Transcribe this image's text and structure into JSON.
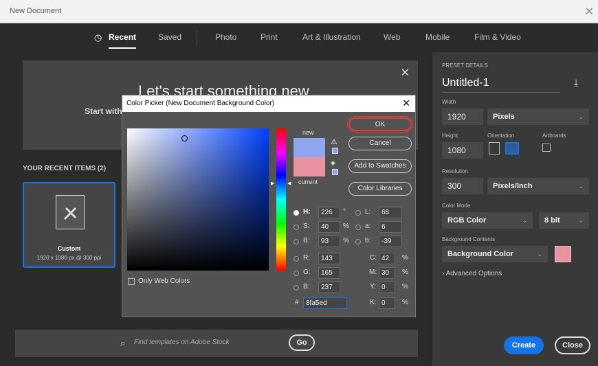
{
  "window": {
    "title": "New Document"
  },
  "nav": {
    "tabs": [
      "Recent",
      "Saved",
      "Photo",
      "Print",
      "Art & Illustration",
      "Web",
      "Mobile",
      "Film & Video"
    ]
  },
  "hero": {
    "heading": "Let's start something new",
    "subtitle": "Start with"
  },
  "recent": {
    "heading": "YOUR RECENT ITEMS",
    "count": "(2)",
    "items": [
      {
        "name": "Custom",
        "dims": "1920 x 1080 px @ 300 ppi"
      }
    ]
  },
  "search": {
    "placeholder": "Find templates on Adobe Stock",
    "go_label": "Go"
  },
  "preset": {
    "section_label": "PRESET DETAILS",
    "name": "Untitled-1",
    "width_label": "Width",
    "width": "1920",
    "width_unit": "Pixels",
    "height_label": "Height",
    "height": "1080",
    "orientation_label": "Orientation",
    "artboards_label": "Artboards",
    "resolution_label": "Resolution",
    "resolution": "300",
    "resolution_unit": "Pixels/Inch",
    "color_mode_label": "Color Mode",
    "color_mode": "RGB Color",
    "bit_depth": "8 bit",
    "bg_label": "Background Contents",
    "bg_value": "Background Color",
    "bg_swatch": "#e8939f",
    "advanced": "Advanced Options"
  },
  "color_picker": {
    "title": "Color Picker (New Document Background Color)",
    "new_label": "new",
    "current_label": "current",
    "new_color": "#8fa5ed",
    "current_color": "#e8939f",
    "ok": "OK",
    "cancel": "Cancel",
    "add_swatches": "Add to Swatches",
    "color_libraries": "Color Libraries",
    "only_web": "Only Web Colors",
    "H": "226",
    "S": "40",
    "B": "93",
    "R": "143",
    "G": "165",
    "Bv": "237",
    "L": "68",
    "a": "6",
    "b": "-39",
    "C": "42",
    "M": "30",
    "Y": "0",
    "K": "0",
    "hex": "8fa5ed",
    "deg": "°",
    "pct": "%",
    "hash": "#"
  },
  "footer": {
    "create": "Create",
    "close": "Close"
  },
  "colors": {
    "accent": "#1473e6",
    "ok_highlight": "#e03c3c"
  }
}
